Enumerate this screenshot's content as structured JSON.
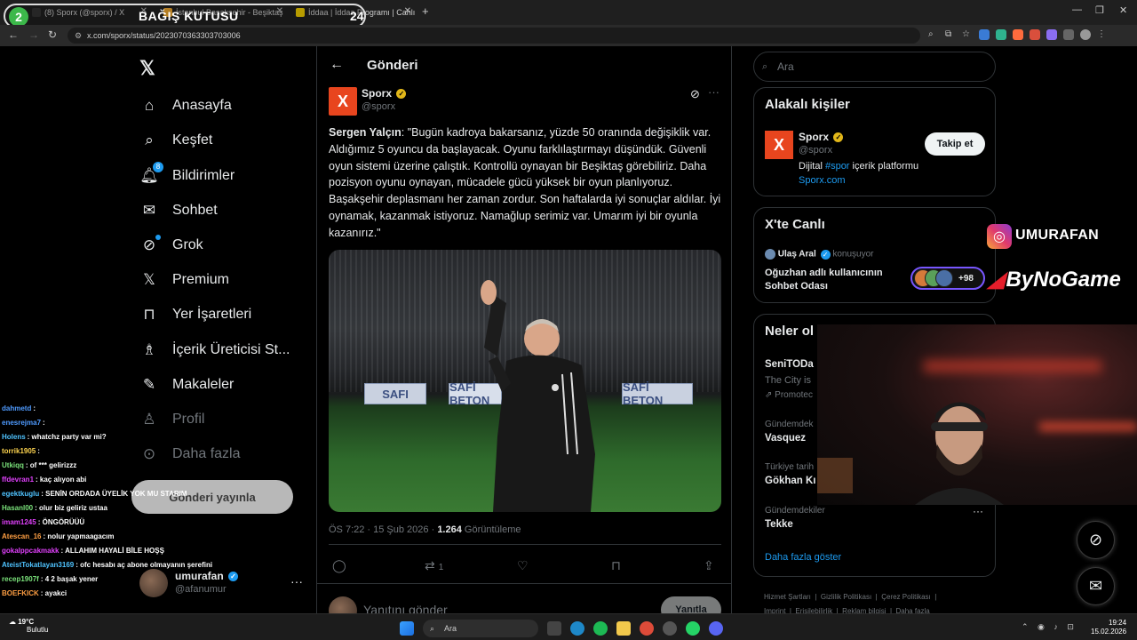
{
  "overlay": {
    "donation_number": "2",
    "donation_title": "BAĞIŞ KUTUSU",
    "donation_count": "24",
    "instagram_handle": "UMURAFAN",
    "brand": "ByNoGame"
  },
  "browser": {
    "tabs": [
      {
        "label": "(8) Sporx (@sporx) / X"
      },
      {
        "label": "İstanbul Başakşehir - Beşiktaş"
      },
      {
        "label": "İddaa | İddaa Programı | Canlı İddaa"
      }
    ],
    "url": "x.com/sporx/status/2023070363303703006"
  },
  "nav": {
    "items": [
      {
        "label": "Anasayfa",
        "icon": "home-icon"
      },
      {
        "label": "Keşfet",
        "icon": "search-icon"
      },
      {
        "label": "Bildirimler",
        "icon": "bell-icon",
        "badge": "8"
      },
      {
        "label": "Sohbet",
        "icon": "mail-icon"
      },
      {
        "label": "Grok",
        "icon": "grok-icon"
      },
      {
        "label": "Premium",
        "icon": "x-logo-icon"
      },
      {
        "label": "Yer İşaretleri",
        "icon": "bookmark-icon"
      },
      {
        "label": "İçerik Üreticisi St...",
        "icon": "creator-icon"
      },
      {
        "label": "Makaleler",
        "icon": "article-icon"
      },
      {
        "label": "Profil",
        "icon": "profile-icon"
      },
      {
        "label": "Daha fazla",
        "icon": "more-circle-icon"
      }
    ],
    "post_button": "Gönderi yayınla",
    "user": {
      "name": "umurafan",
      "handle": "@afanumur"
    }
  },
  "chat": [
    {
      "user": "dahmetd",
      "color": "#4f9bff",
      "msg": ":"
    },
    {
      "user": "enesrejma7",
      "color": "#4f9bff",
      "msg": ":"
    },
    {
      "user": "Holens",
      "color": "#4fc3ff",
      "msg": ": whatchz party var mi?"
    },
    {
      "user": "torrik1905",
      "color": "#ffd54f",
      "msg": ":"
    },
    {
      "user": "Utkiqq",
      "color": "#7be37b",
      "msg": ": of *** gelirizzz"
    },
    {
      "user": "ffdevran1",
      "color": "#e040fb",
      "msg": ": kaç alıyon abi"
    },
    {
      "user": "egektkuglu",
      "color": "#4fc3ff",
      "msg": ": SENİN ORDADA ÜYELİK YOK MU STARIM"
    },
    {
      "user": "Hasanl00",
      "color": "#7be37b",
      "msg": ": olur biz geliriz ustaa"
    },
    {
      "user": "imam1245",
      "color": "#e040fb",
      "msg": ": ÖNGÖRÜÜÜ"
    },
    {
      "user": "Atescan_16",
      "color": "#ff9f43",
      "msg": ": nolur yapmaagacım"
    },
    {
      "user": "gokalppcakmakk",
      "color": "#e040fb",
      "msg": ": ALLAHIM HAYALİ BİLE HOŞŞ"
    },
    {
      "user": "AteistTokatlayan3169",
      "color": "#4fc3ff",
      "msg": ": ofc hesabı aç abone olmayanın şerefini"
    },
    {
      "user": "recep1907f",
      "color": "#7be37b",
      "msg": ": 4 2 başak yener"
    },
    {
      "user": "BOEFKICK",
      "color": "#ff9f43",
      "msg": ": ayakci"
    }
  ],
  "post": {
    "header_title": "Gönderi",
    "account_name": "Sporx",
    "account_handle": "@sporx",
    "speaker": "Sergen Yalçın",
    "text": ": \"Bugün kadroya bakarsanız, yüzde 50 oranında değişiklik var. Aldığımız 5 oyuncu da başlayacak. Oyunu farklılaştırmayı düşündük. Güvenli oyun sistemi üzerine çalıştık. Kontrollü oynayan bir Beşiktaş görebiliriz. Daha pozisyon oyunu oynayan, mücadele gücü yüksek bir oyun planlıyoruz. Başakşehir deplasmanı her zaman zordur. Son haftalarda iyi sonuçlar aldılar. İyi oynamak, kazanmak istiyoruz. Namağlup serimiz var. Umarım iyi bir oyunla kazanırız.\"",
    "time": "ÖS 7:22 · 15 Şub 2026 ·",
    "views": "1.264",
    "views_label": "Görüntüleme",
    "retweets": "1",
    "reply_placeholder": "Yanıtını gönder",
    "reply_button": "Yanıtla",
    "photo_boards": [
      "SAFI",
      "SAFİ BETON",
      "SAFİ BETON"
    ]
  },
  "right": {
    "search_placeholder": "Ara",
    "related_title": "Alakalı kişiler",
    "related": {
      "name": "Sporx",
      "handle": "@sporx",
      "bio_pre": "Dijital ",
      "bio_tag": "#spor",
      "bio_post": " içerik platformu",
      "link": "Sporx.com",
      "follow": "Takip et"
    },
    "live_title": "X'te Canlı",
    "live": {
      "host": "Ulaş Aral",
      "status": "konuşuyor",
      "room": "Oğuzhan adlı kullanıcının Sohbet Odası",
      "count": "+98"
    },
    "trends_title": "Neler ol",
    "trends": [
      {
        "small": "",
        "big": "SeniTODa",
        "sub": "The City is"
      },
      {
        "small": "Promotec",
        "big": "",
        "sub": ""
      },
      {
        "small": "Gündemdek",
        "big": "Vasquez",
        "sub": ""
      },
      {
        "small": "Türkiye tarih",
        "big": "Gökhan Kı",
        "sub": ""
      },
      {
        "small": "Gündemdekiler",
        "big": "Tekke",
        "sub": ""
      }
    ],
    "show_more": "Daha fazla göster",
    "footer": [
      "Hizmet Şartları",
      "Gizlilik Politikası",
      "Çerez Politikası",
      "Imprint",
      "Erişilebilirlik",
      "Reklam bilgisi",
      "Daha fazla"
    ]
  },
  "taskbar": {
    "temp": "19°C",
    "weather": "Bulutlu",
    "search": "Ara",
    "time": "19:24",
    "date": "15.02.2026"
  }
}
